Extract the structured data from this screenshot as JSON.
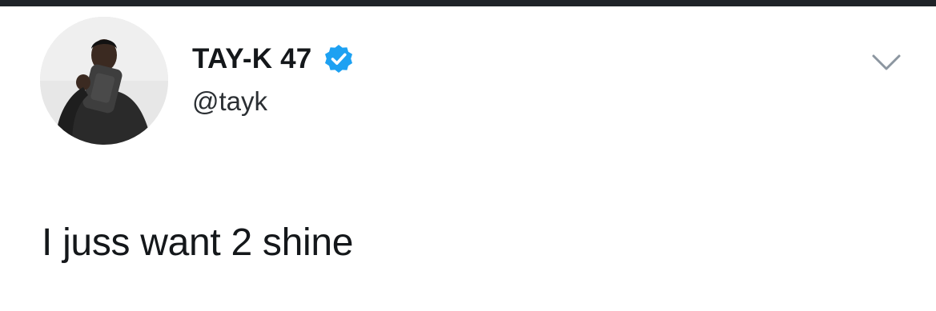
{
  "tweet": {
    "author": {
      "display_name": "TAY-K 47",
      "handle": "@tayk",
      "verified": true,
      "avatar_icon": "profile-photo"
    },
    "text": "I juss want 2 shine",
    "menu_icon": "chevron-down-icon"
  },
  "colors": {
    "verified_blue": "#1da1f2",
    "top_bar": "#1f2328",
    "text": "#14171a"
  }
}
